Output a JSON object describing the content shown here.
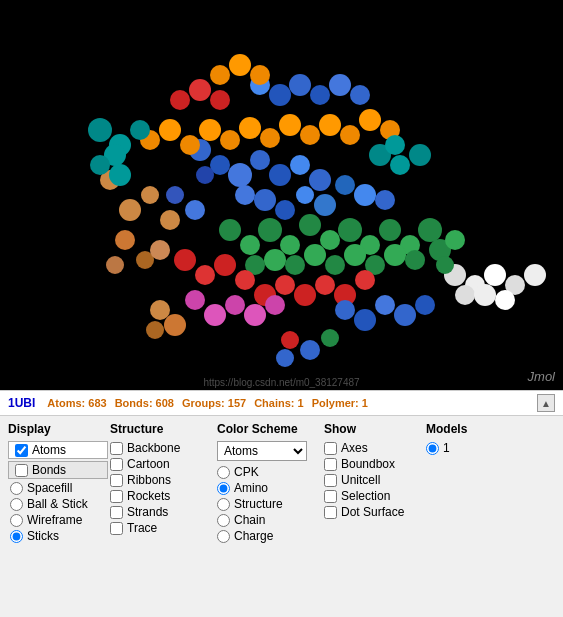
{
  "viewer": {
    "jmol_label": "Jmol"
  },
  "status": {
    "pdb": "1UBI",
    "atoms_label": "Atoms:",
    "atoms_value": "683",
    "bonds_label": "Bonds:",
    "bonds_value": "608",
    "groups_label": "Groups:",
    "groups_value": "157",
    "chains_label": "Chains:",
    "chains_value": "1",
    "polymer_label": "Polymer:",
    "polymer_value": "1"
  },
  "display": {
    "title": "Display",
    "items": [
      {
        "label": "Atoms",
        "type": "checkbox",
        "checked": true
      },
      {
        "label": "Bonds",
        "type": "checkbox",
        "checked": false
      },
      {
        "label": "Spacefill",
        "type": "radio",
        "checked": false
      },
      {
        "label": "Ball & Stick",
        "type": "radio",
        "checked": false
      },
      {
        "label": "Wireframe",
        "type": "radio",
        "checked": false
      },
      {
        "label": "Sticks",
        "type": "radio",
        "checked": true
      }
    ]
  },
  "structure": {
    "title": "Structure",
    "items": [
      {
        "label": "Backbone",
        "checked": false
      },
      {
        "label": "Cartoon",
        "checked": false
      },
      {
        "label": "Ribbons",
        "checked": false
      },
      {
        "label": "Rockets",
        "checked": false
      },
      {
        "label": "Strands",
        "checked": false
      },
      {
        "label": "Trace",
        "checked": false
      }
    ]
  },
  "color_scheme": {
    "title": "Color Scheme",
    "selected": "Atoms",
    "options": [
      "Atoms",
      "CPK",
      "Amino",
      "Structure",
      "Chain",
      "Charge"
    ],
    "items": [
      {
        "label": "CPK",
        "type": "radio",
        "checked": false
      },
      {
        "label": "Amino",
        "type": "radio",
        "checked": true
      },
      {
        "label": "Structure",
        "type": "radio",
        "checked": false
      },
      {
        "label": "Chain",
        "type": "radio",
        "checked": false
      },
      {
        "label": "Charge",
        "type": "radio",
        "checked": false
      }
    ]
  },
  "show": {
    "title": "Show",
    "items": [
      {
        "label": "Axes",
        "checked": false
      },
      {
        "label": "Boundbox",
        "checked": false
      },
      {
        "label": "Unitcell",
        "checked": false
      },
      {
        "label": "Selection",
        "checked": false
      },
      {
        "label": "Dot Surface",
        "checked": false
      }
    ]
  },
  "models": {
    "title": "Models",
    "items": [
      {
        "label": "1",
        "checked": true
      }
    ]
  },
  "watermark": "https://blog.csdn.net/m0_38127487"
}
